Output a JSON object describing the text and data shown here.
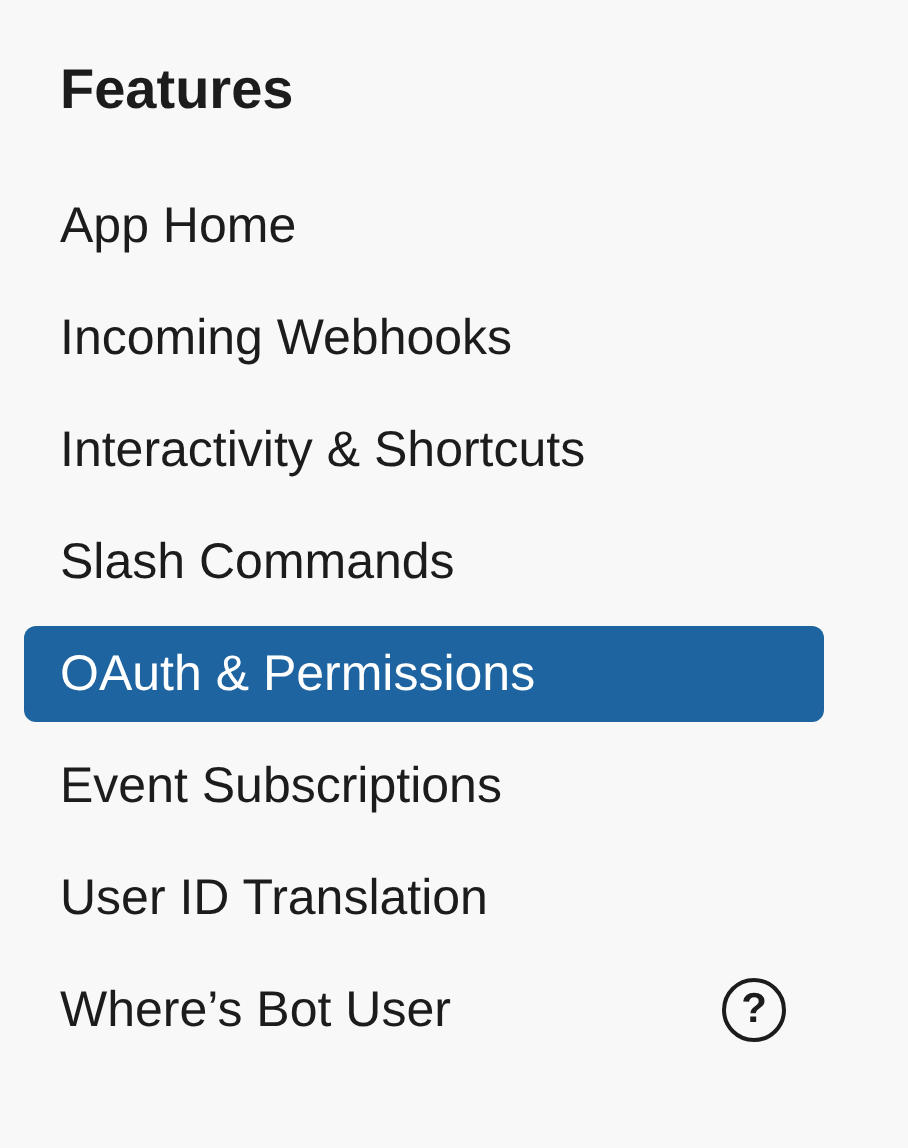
{
  "section": {
    "title": "Features"
  },
  "items": [
    {
      "label": "App Home",
      "selected": false
    },
    {
      "label": "Incoming Webhooks",
      "selected": false
    },
    {
      "label": "Interactivity & Shortcuts",
      "selected": false
    },
    {
      "label": "Slash Commands",
      "selected": false
    },
    {
      "label": "OAuth & Permissions",
      "selected": true
    },
    {
      "label": "Event Subscriptions",
      "selected": false
    },
    {
      "label": "User ID Translation",
      "selected": false
    },
    {
      "label": "Where’s Bot User",
      "selected": false,
      "help": "?"
    }
  ]
}
